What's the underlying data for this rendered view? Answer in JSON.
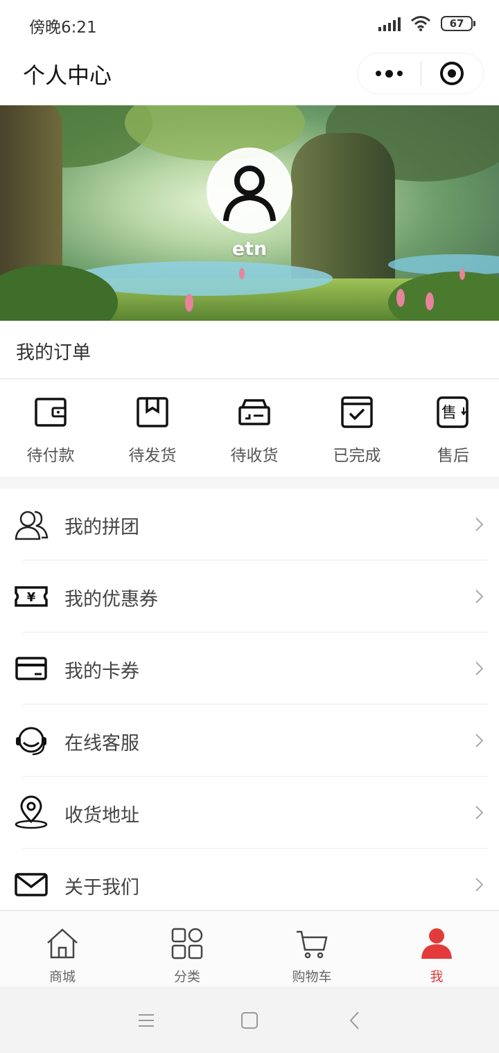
{
  "status_bar": {
    "time": "傍晚6:21",
    "battery": "67"
  },
  "nav": {
    "title": "个人中心"
  },
  "profile": {
    "username": "etn"
  },
  "orders": {
    "title": "我的订单",
    "items": [
      {
        "label": "待付款",
        "icon": "wallet-icon"
      },
      {
        "label": "待发货",
        "icon": "package-icon"
      },
      {
        "label": "待收货",
        "icon": "delivery-box-icon"
      },
      {
        "label": "已完成",
        "icon": "calendar-check-icon"
      },
      {
        "label": "售后",
        "icon": "after-sale-icon"
      }
    ]
  },
  "menu": {
    "items": [
      {
        "label": "我的拼团",
        "icon": "group-users-icon"
      },
      {
        "label": "我的优惠券",
        "icon": "coupon-yen-icon"
      },
      {
        "label": "我的卡券",
        "icon": "card-icon"
      },
      {
        "label": "在线客服",
        "icon": "headset-icon"
      },
      {
        "label": "收货地址",
        "icon": "location-pin-icon"
      },
      {
        "label": "关于我们",
        "icon": "mail-icon"
      }
    ]
  },
  "tabbar": {
    "items": [
      {
        "label": "商城",
        "icon": "home-icon",
        "active": false
      },
      {
        "label": "分类",
        "icon": "category-icon",
        "active": false
      },
      {
        "label": "购物车",
        "icon": "cart-icon",
        "active": false
      },
      {
        "label": "我",
        "icon": "user-icon",
        "active": true
      }
    ],
    "active_color": "#e33b3b"
  }
}
